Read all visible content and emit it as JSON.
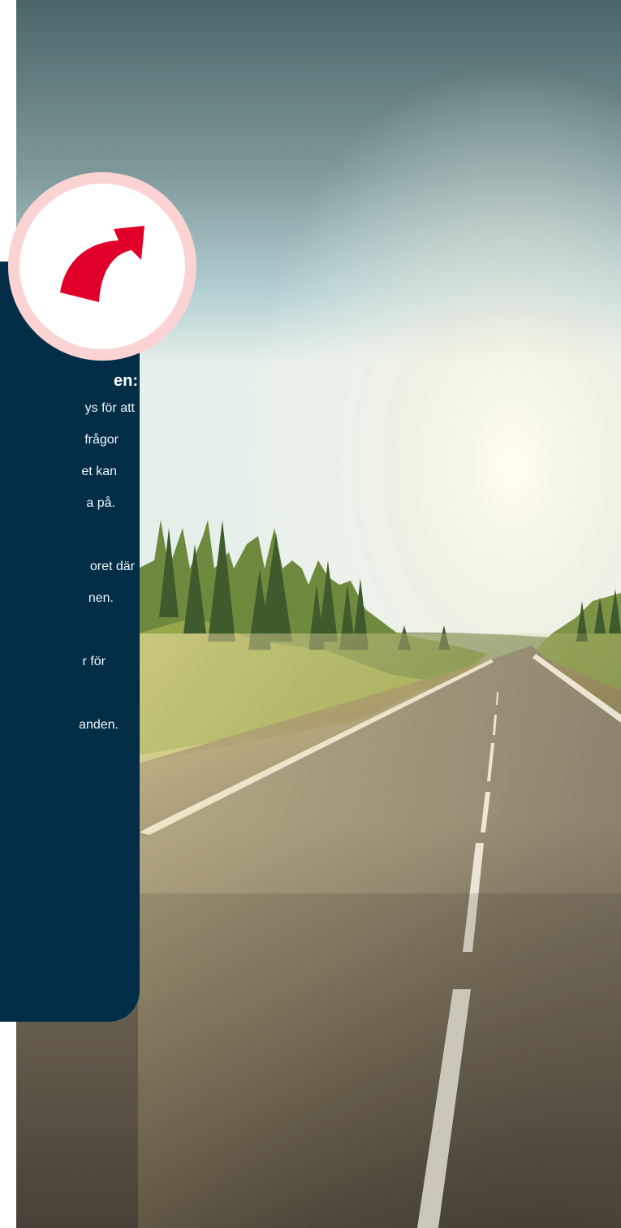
{
  "card": {
    "heading": "en:",
    "lines": [
      "ys för att",
      "frågor",
      "et kan",
      "a på.",
      "oret där",
      "nen.",
      "r för",
      "anden."
    ]
  },
  "badge": {
    "icon": "arrow-turn-up-right-icon",
    "accent_color": "#e0002a",
    "ring_color": "#fbd3d3"
  },
  "colors": {
    "card_background": "#022d47",
    "sky_top": "#4e6a6f",
    "sky_bottom": "#dce9e4",
    "road": "#6f6657"
  }
}
